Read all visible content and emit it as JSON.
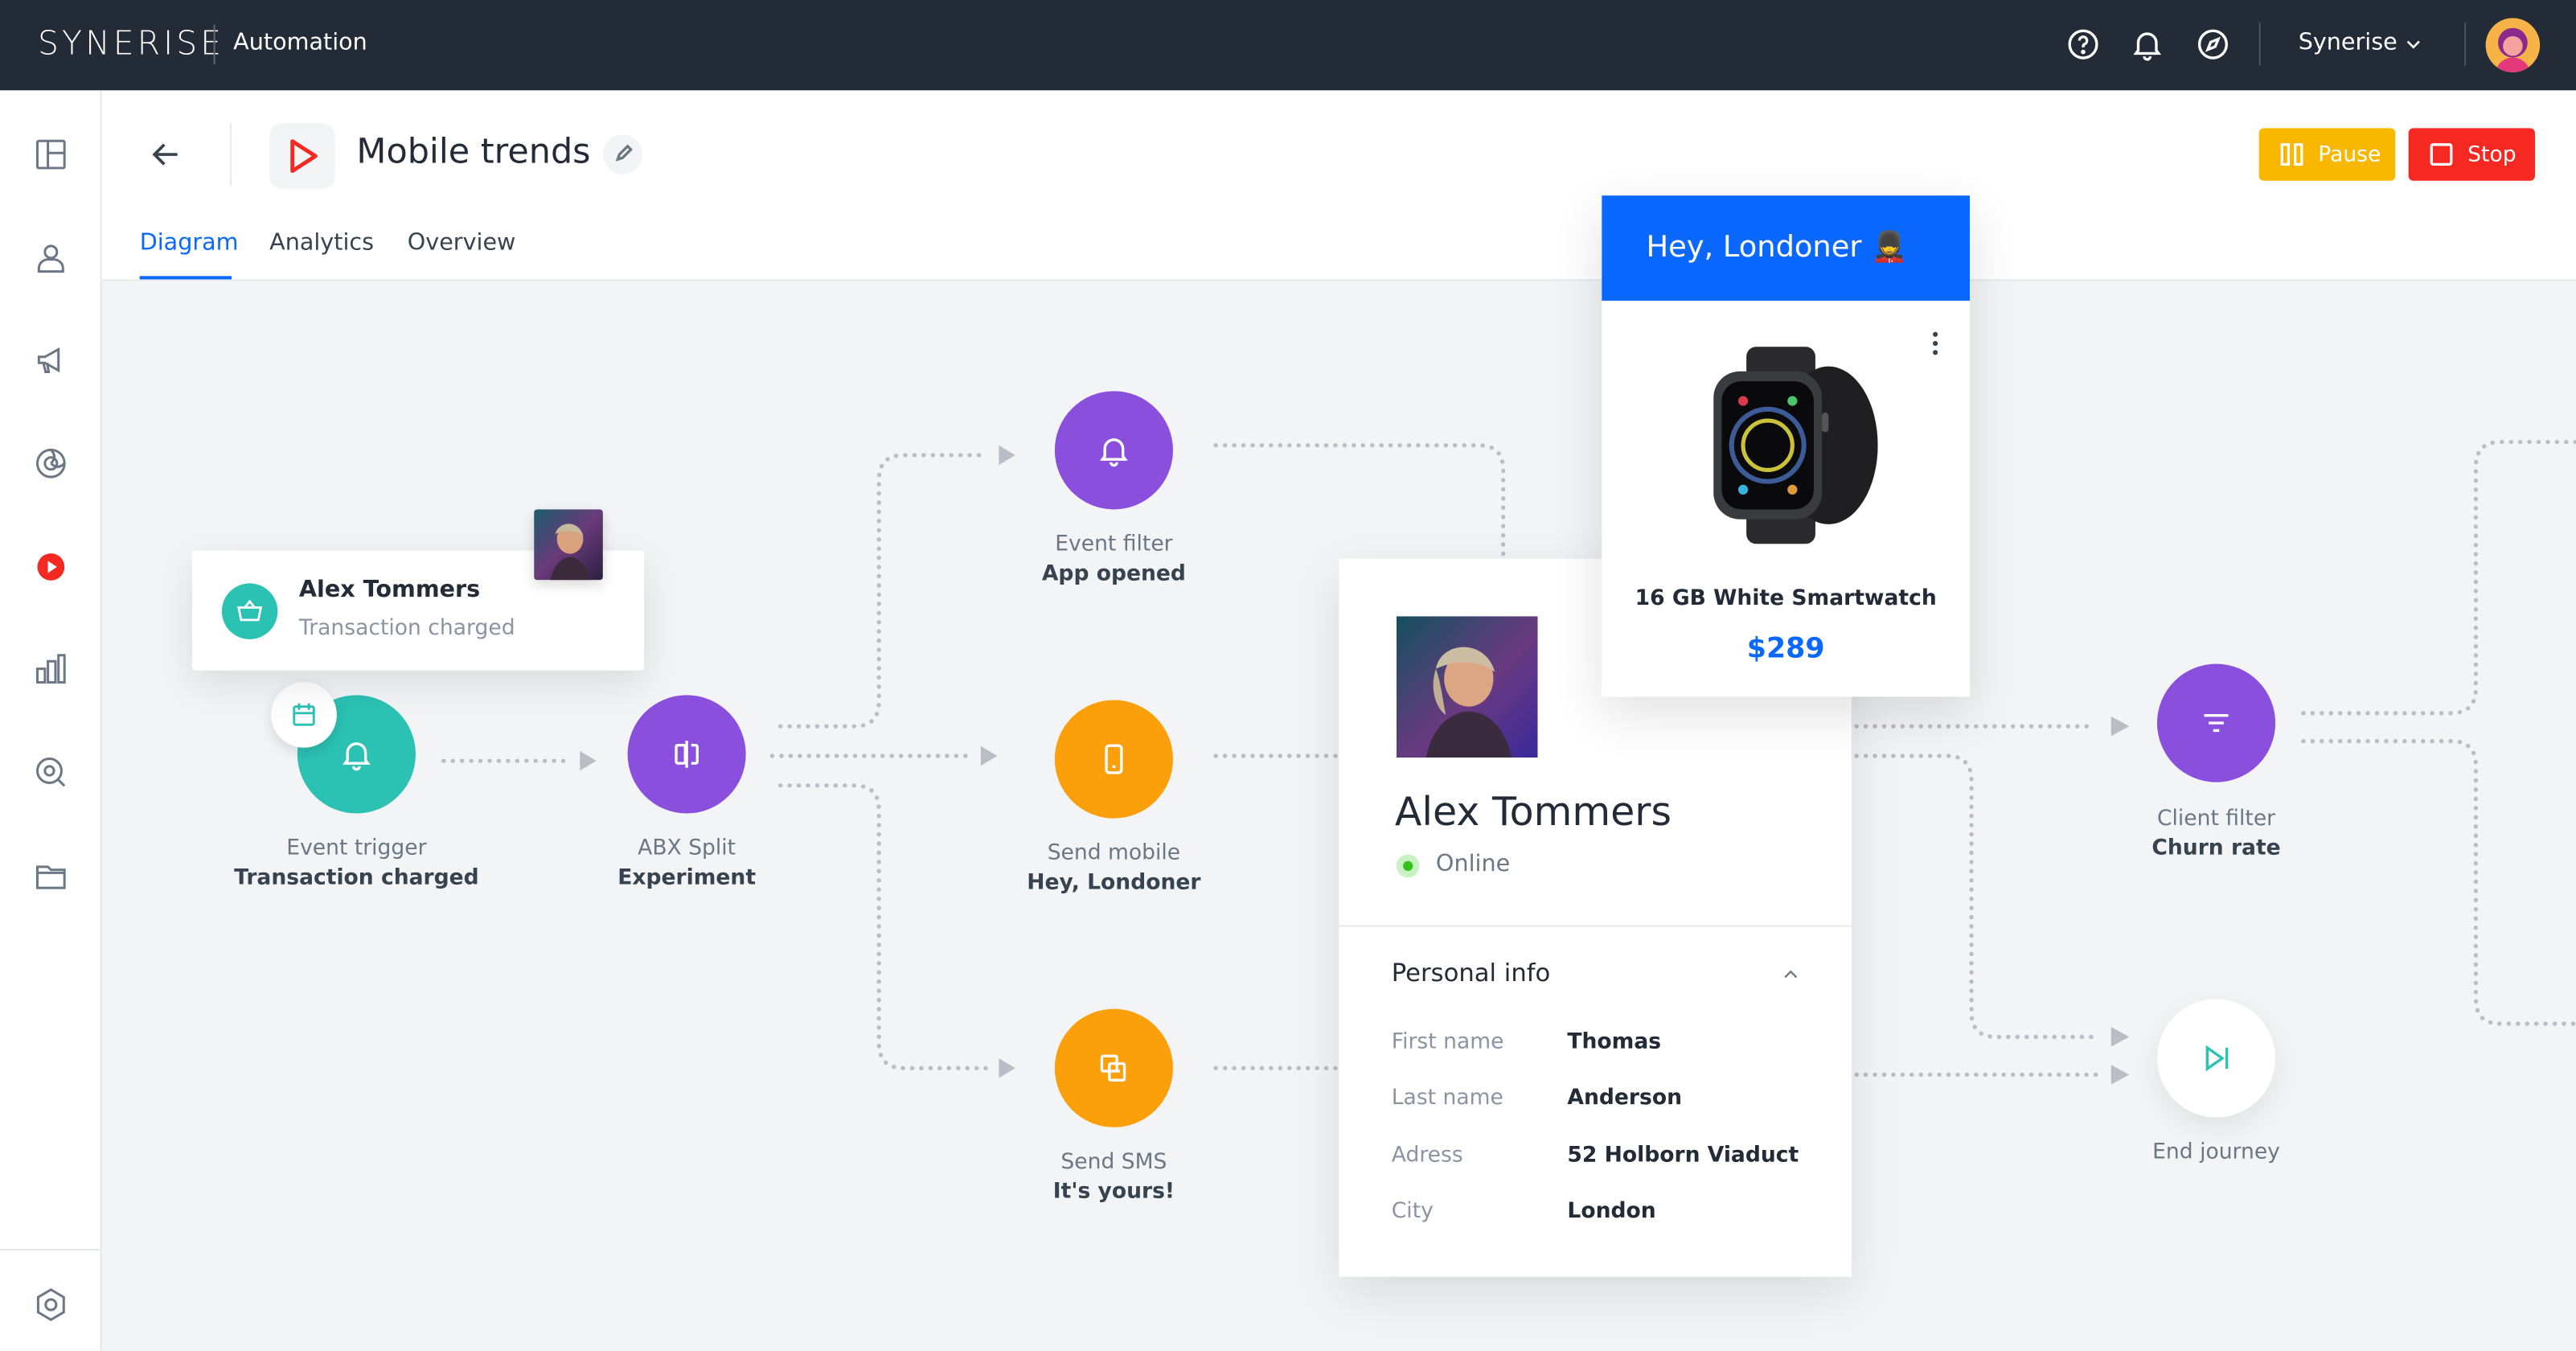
{
  "topbar": {
    "logo": "SYNERISE",
    "app_name": "Automation",
    "org_name": "Synerise",
    "icons": [
      "help-icon",
      "bell-icon",
      "compass-icon",
      "chevron-down-icon"
    ]
  },
  "sidebar": {
    "icons": [
      "dashboard-icon",
      "profiles-icon",
      "campaigns-icon",
      "ai-icon",
      "automation-icon",
      "analytics-icon",
      "search-analytics-icon",
      "assets-icon",
      "settings-icon"
    ],
    "active": "automation-icon"
  },
  "header": {
    "title": "Mobile trends",
    "tabs": [
      {
        "label": "Diagram",
        "active": true
      },
      {
        "label": "Analytics",
        "active": false
      },
      {
        "label": "Overview",
        "active": false
      }
    ],
    "pause_label": "Pause",
    "stop_label": "Stop"
  },
  "colors": {
    "topbar": "#232b36",
    "accent_blue": "#0b68ff",
    "pause": "#fab700",
    "stop": "#f52922",
    "teal": "#2bc2b4",
    "purple": "#8a4fdc",
    "orange": "#fb9f0a"
  },
  "nodes": {
    "event_trigger": {
      "title": "Event trigger",
      "sub": "Transaction charged"
    },
    "abx_split": {
      "title": "ABX Split",
      "sub": "Experiment"
    },
    "event_filter": {
      "title": "Event filter",
      "sub": "App opened"
    },
    "send_mobile": {
      "title": "Send mobile",
      "sub": "Hey, Londoner"
    },
    "send_sms": {
      "title": "Send SMS",
      "sub": "It's yours!"
    },
    "client_filter": {
      "title": "Client filter",
      "sub": "Churn rate"
    },
    "end_journey": {
      "title": "End journey"
    }
  },
  "toast": {
    "name": "Alex Tommers",
    "event": "Transaction charged"
  },
  "profile": {
    "name": "Alex Tommers",
    "status": "Online",
    "section": "Personal info",
    "fields": [
      {
        "label": "First name",
        "value": "Thomas"
      },
      {
        "label": "Last name",
        "value": "Anderson"
      },
      {
        "label": "Adress",
        "value": "52 Holborn Viaduct"
      },
      {
        "label": "City",
        "value": "London"
      }
    ]
  },
  "promo": {
    "header": "Hey, Londoner 💂",
    "product": "16 GB White Smartwatch",
    "price": "$289"
  }
}
